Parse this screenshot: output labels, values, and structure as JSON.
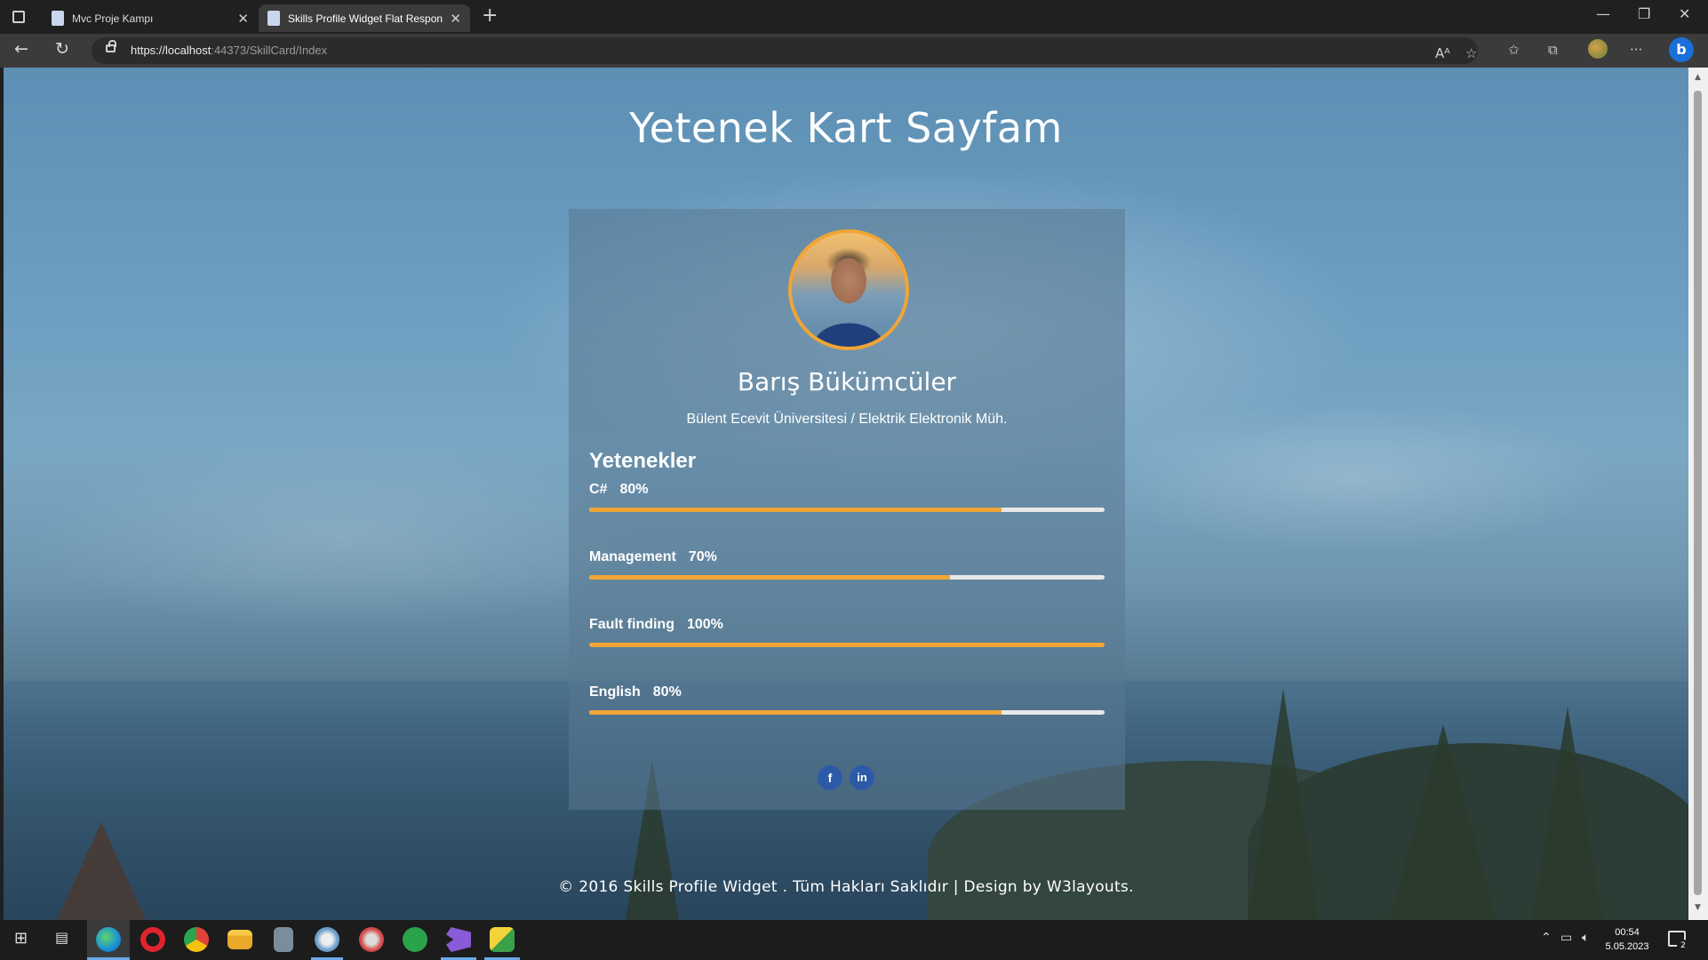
{
  "browser": {
    "tabs": [
      {
        "title": "Mvc Proje Kampı",
        "active": false
      },
      {
        "title": "Skills Profile Widget Flat Respon",
        "active": true
      }
    ],
    "url_host": "https://localhost",
    "url_path": ":44373/SkillCard/Index"
  },
  "page": {
    "title": "Yetenek Kart Sayfam",
    "profile": {
      "name": "Barış Bükümcüler",
      "subtitle": "Bülent Ecevit Üniversitesi / Elektrik Elektronik Müh."
    },
    "skills_heading": "Yetenekler",
    "skills": [
      {
        "name": "C#",
        "percent_label": "80%",
        "value": 80
      },
      {
        "name": "Management",
        "percent_label": "70%",
        "value": 70
      },
      {
        "name": "Fault finding",
        "percent_label": "100%",
        "value": 100
      },
      {
        "name": "English",
        "percent_label": "80%",
        "value": 80
      }
    ],
    "social": {
      "facebook": "f",
      "linkedin": "in"
    },
    "footer": "© 2016 Skills Profile Widget . Tüm Hakları Saklıdır | Design by W3layouts."
  },
  "colors": {
    "accent": "#f0a535",
    "track": "#e8e8e8",
    "social": "#2d5aa6"
  },
  "taskbar": {
    "clock_time": "00:54",
    "clock_date": "5.05.2023",
    "notification_count": "2"
  }
}
